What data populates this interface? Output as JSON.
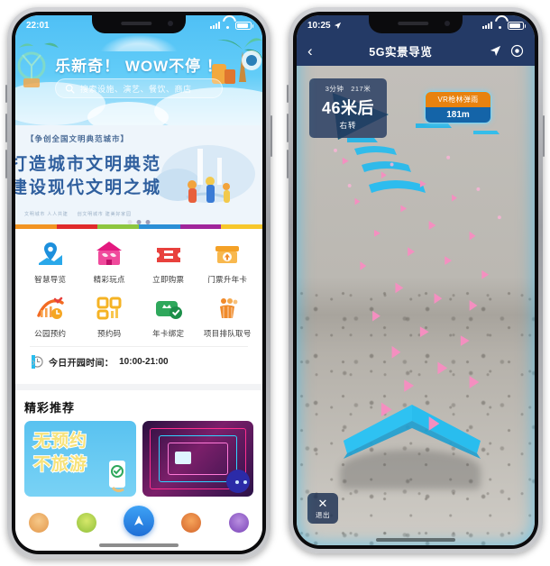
{
  "left_phone": {
    "status_bar": {
      "time": "22:01",
      "signal_icon": "signal-bars-icon",
      "wifi_icon": "wifi-icon",
      "battery_icon": "battery-icon"
    },
    "hero": {
      "logo_label": "园区品牌logo",
      "slogan": "乐新奇！ WOW不停 ！",
      "search_placeholder": "搜索设施、演艺、餐饮、商店",
      "search_icon": "search-icon"
    },
    "city_banner": {
      "tag": "【争创全国文明典范城市】",
      "line1": "打造城市文明典范",
      "line2": "建设现代文明之城",
      "sub_left": "文明城市 人人共建",
      "sub_right": "创文明城市 建美好家园",
      "dots_total": 3,
      "dots_active_index": 1
    },
    "stripe_colors": [
      "#f29422",
      "#e02b2b",
      "#8dc63f",
      "#2b8fd6",
      "#a0259b",
      "#f7c72b"
    ],
    "grid": [
      {
        "label": "智慧导览",
        "icon": "map-pin-icon",
        "color": "#1f9fe8"
      },
      {
        "label": "精彩玩点",
        "icon": "carousel-icon",
        "color": "#e3197f"
      },
      {
        "label": "立即购票",
        "icon": "ticket-icon",
        "color": "#e8413d"
      },
      {
        "label": "门票升年卡",
        "icon": "upgrade-card-icon",
        "color": "#f4a127"
      },
      {
        "label": "公园预约",
        "icon": "reserve-clock-icon",
        "color": "#f26a21"
      },
      {
        "label": "预约码",
        "icon": "qr-code-icon",
        "color": "#f5b324"
      },
      {
        "label": "年卡绑定",
        "icon": "bind-card-icon",
        "color": "#2fa85c"
      },
      {
        "label": "项目排队取号",
        "icon": "queue-number-icon",
        "color": "#f08a2a"
      }
    ],
    "hours_row": {
      "icon": "clock-icon",
      "label": "今日开园时间：",
      "value": "10:00-21:00",
      "chevron": "chevron-right-icon"
    },
    "recommend": {
      "title": "精彩推荐",
      "cards": [
        {
          "line1": "无预约",
          "line2": "不旅游",
          "kind": "blue-poster"
        },
        {
          "kind": "neon-ride-photo",
          "alt": "霓虹游乐项目"
        }
      ]
    },
    "tabbar": {
      "items": [
        {
          "name": "tab-home",
          "icon": "character-home-icon"
        },
        {
          "name": "tab-play",
          "icon": "character-play-icon"
        },
        {
          "name": "tab-navigate",
          "icon": "navigate-arrow-icon"
        },
        {
          "name": "tab-mall",
          "icon": "character-mall-icon"
        },
        {
          "name": "tab-mine",
          "icon": "character-mine-icon"
        }
      ]
    }
  },
  "right_phone": {
    "status_bar": {
      "time": "10:25",
      "location_icon": "location-arrow-icon",
      "signal_icon": "signal-bars-icon",
      "wifi_icon": "wifi-icon",
      "battery_icon": "battery-icon"
    },
    "nav_bar": {
      "back_icon": "chevron-left-icon",
      "title": "5G实景导览",
      "action_navigate_icon": "navigate-arrow-icon",
      "action_locate_icon": "target-locate-icon"
    },
    "info_card": {
      "duration": "3分钟",
      "total_distance": "217米",
      "next_distance": "46米后",
      "turn": "右转"
    },
    "poi_label": {
      "title": "VR枪林弹雨",
      "distance": "181m"
    },
    "exit_button": {
      "icon": "close-x-icon",
      "label": "退出"
    },
    "ar_colors": {
      "chevron": "#29bdee",
      "arrow_dark": "#1b5f7c",
      "particle": "#f48fc0"
    }
  }
}
